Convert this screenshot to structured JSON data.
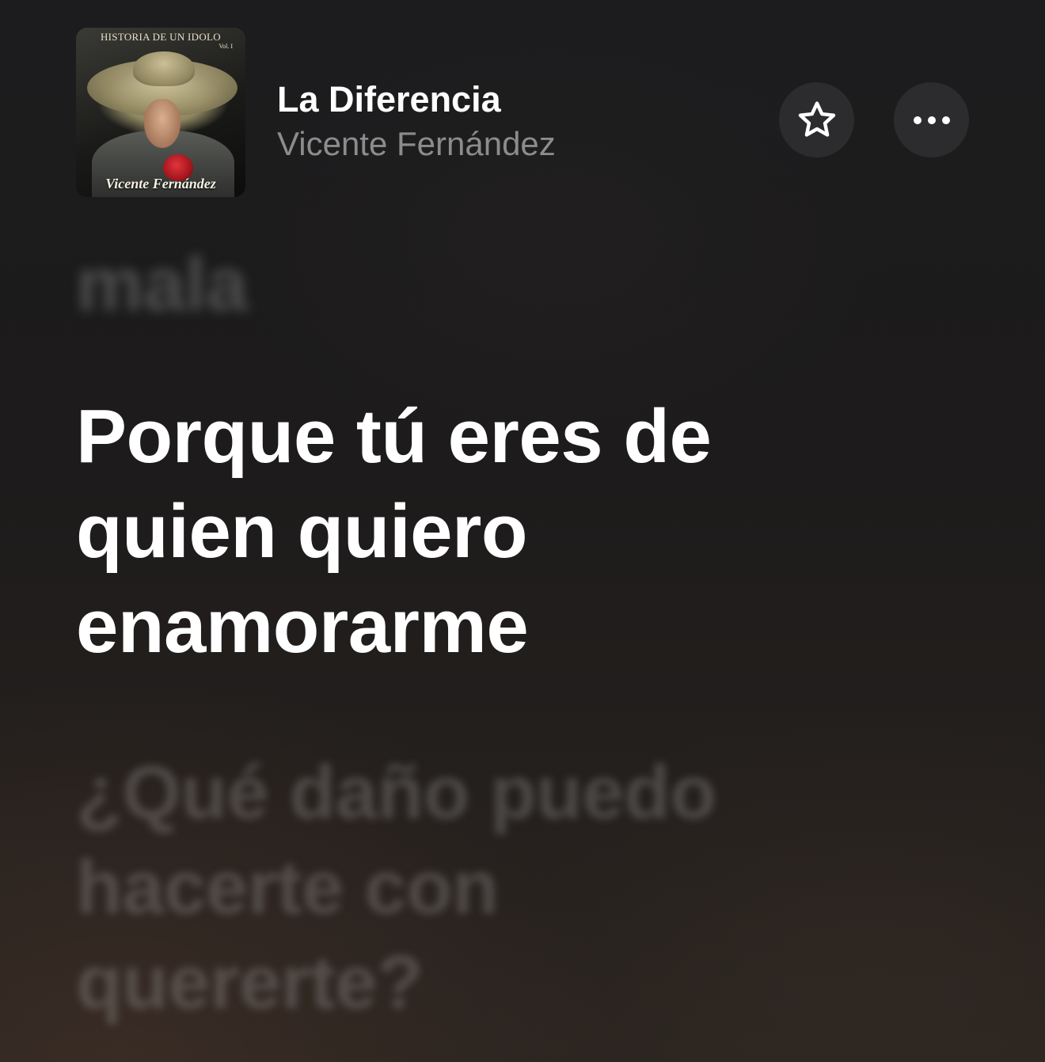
{
  "now_playing": {
    "title": "La Diferencia",
    "artist": "Vicente Fernández",
    "artwork": {
      "top_text": "HISTORIA DE UN IDOLO",
      "volume_text": "Vol. I",
      "bottom_text": "Vicente Fernández"
    }
  },
  "actions": {
    "favorite_icon": "star-outline-icon",
    "more_icon": "ellipsis-icon"
  },
  "lyrics": {
    "previous": "mala",
    "current_lines": [
      "Porque tú eres de",
      "quien quiero",
      "enamorarme"
    ],
    "next_lines": [
      "¿Qué daño puedo",
      "hacerte con",
      "quererte?"
    ]
  },
  "colors": {
    "background": "#1c1c1e",
    "current_lyric": "#ffffff",
    "artist_text": "#8c8c8c",
    "button_background": "#2c2c2e"
  }
}
